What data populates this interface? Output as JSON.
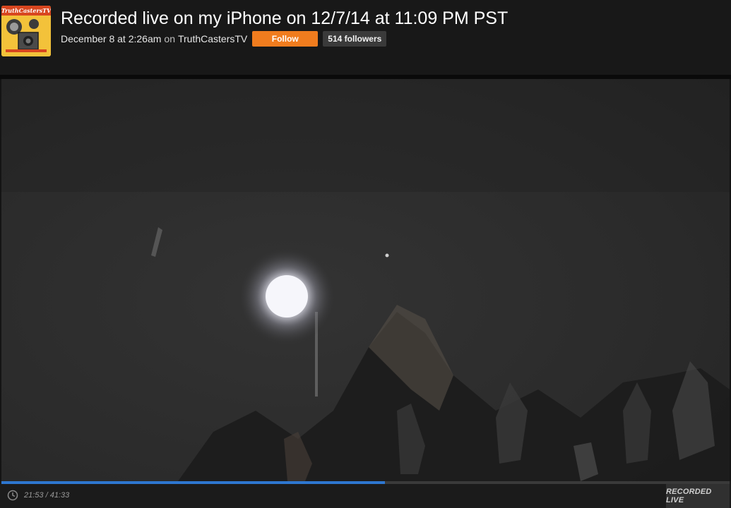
{
  "header": {
    "title": "Recorded live on my iPhone on 12/7/14 at 11:09 PM PST",
    "date": "December 8 at 2:26am",
    "on_text": "on",
    "channel": "TruthCastersTV",
    "follow_label": "Follow",
    "followers_label": "514 followers",
    "avatar_text": "TruthCastersTV"
  },
  "player": {
    "time_display": "21:53 / 41:33",
    "progress": 0.5266,
    "status_label": "RECORDED LIVE",
    "accent_color": "#2e77d0"
  },
  "colors": {
    "follow_button": "#f07c1e",
    "header_bg": "#181818"
  }
}
